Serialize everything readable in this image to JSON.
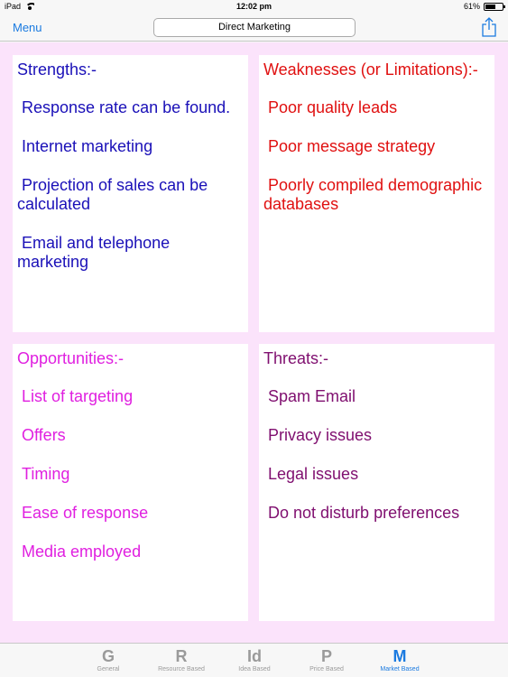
{
  "status_bar": {
    "device": "iPad",
    "time": "12:02 pm",
    "battery_text": "61%",
    "battery_level": 0.61
  },
  "nav": {
    "menu_label": "Menu",
    "title": "Direct Marketing",
    "share_icon": "share-icon"
  },
  "panels": {
    "strengths": {
      "heading": "Strengths:-",
      "items": [
        " Response rate can be found.",
        " Internet marketing",
        " Projection of sales can be calculated",
        " Email and telephone marketing"
      ]
    },
    "weaknesses": {
      "heading": "Weaknesses (or Limitations):-",
      "items": [
        " Poor quality leads",
        " Poor message strategy",
        " Poorly compiled demographic databases"
      ]
    },
    "opportunities": {
      "heading": "Opportunities:-",
      "items": [
        " List of targeting",
        " Offers",
        " Timing",
        " Ease of response",
        " Media employed"
      ]
    },
    "threats": {
      "heading": "Threats:-",
      "items": [
        " Spam Email",
        " Privacy issues",
        " Legal issues",
        " Do not disturb preferences"
      ]
    }
  },
  "tabs": [
    {
      "glyph": "G",
      "label": "General",
      "active": false
    },
    {
      "glyph": "R",
      "label": "Resource Based",
      "active": false
    },
    {
      "glyph": "Id",
      "label": "Idea Based",
      "active": false
    },
    {
      "glyph": "P",
      "label": "Price Based",
      "active": false
    },
    {
      "glyph": "M",
      "label": "Market Based",
      "active": true
    }
  ],
  "colors": {
    "accent": "#1a7ae0",
    "background": "#fbe3fb",
    "strengths": "#1a10b8",
    "weaknesses": "#e01010",
    "opportunities": "#e020e0",
    "threats": "#801070"
  }
}
